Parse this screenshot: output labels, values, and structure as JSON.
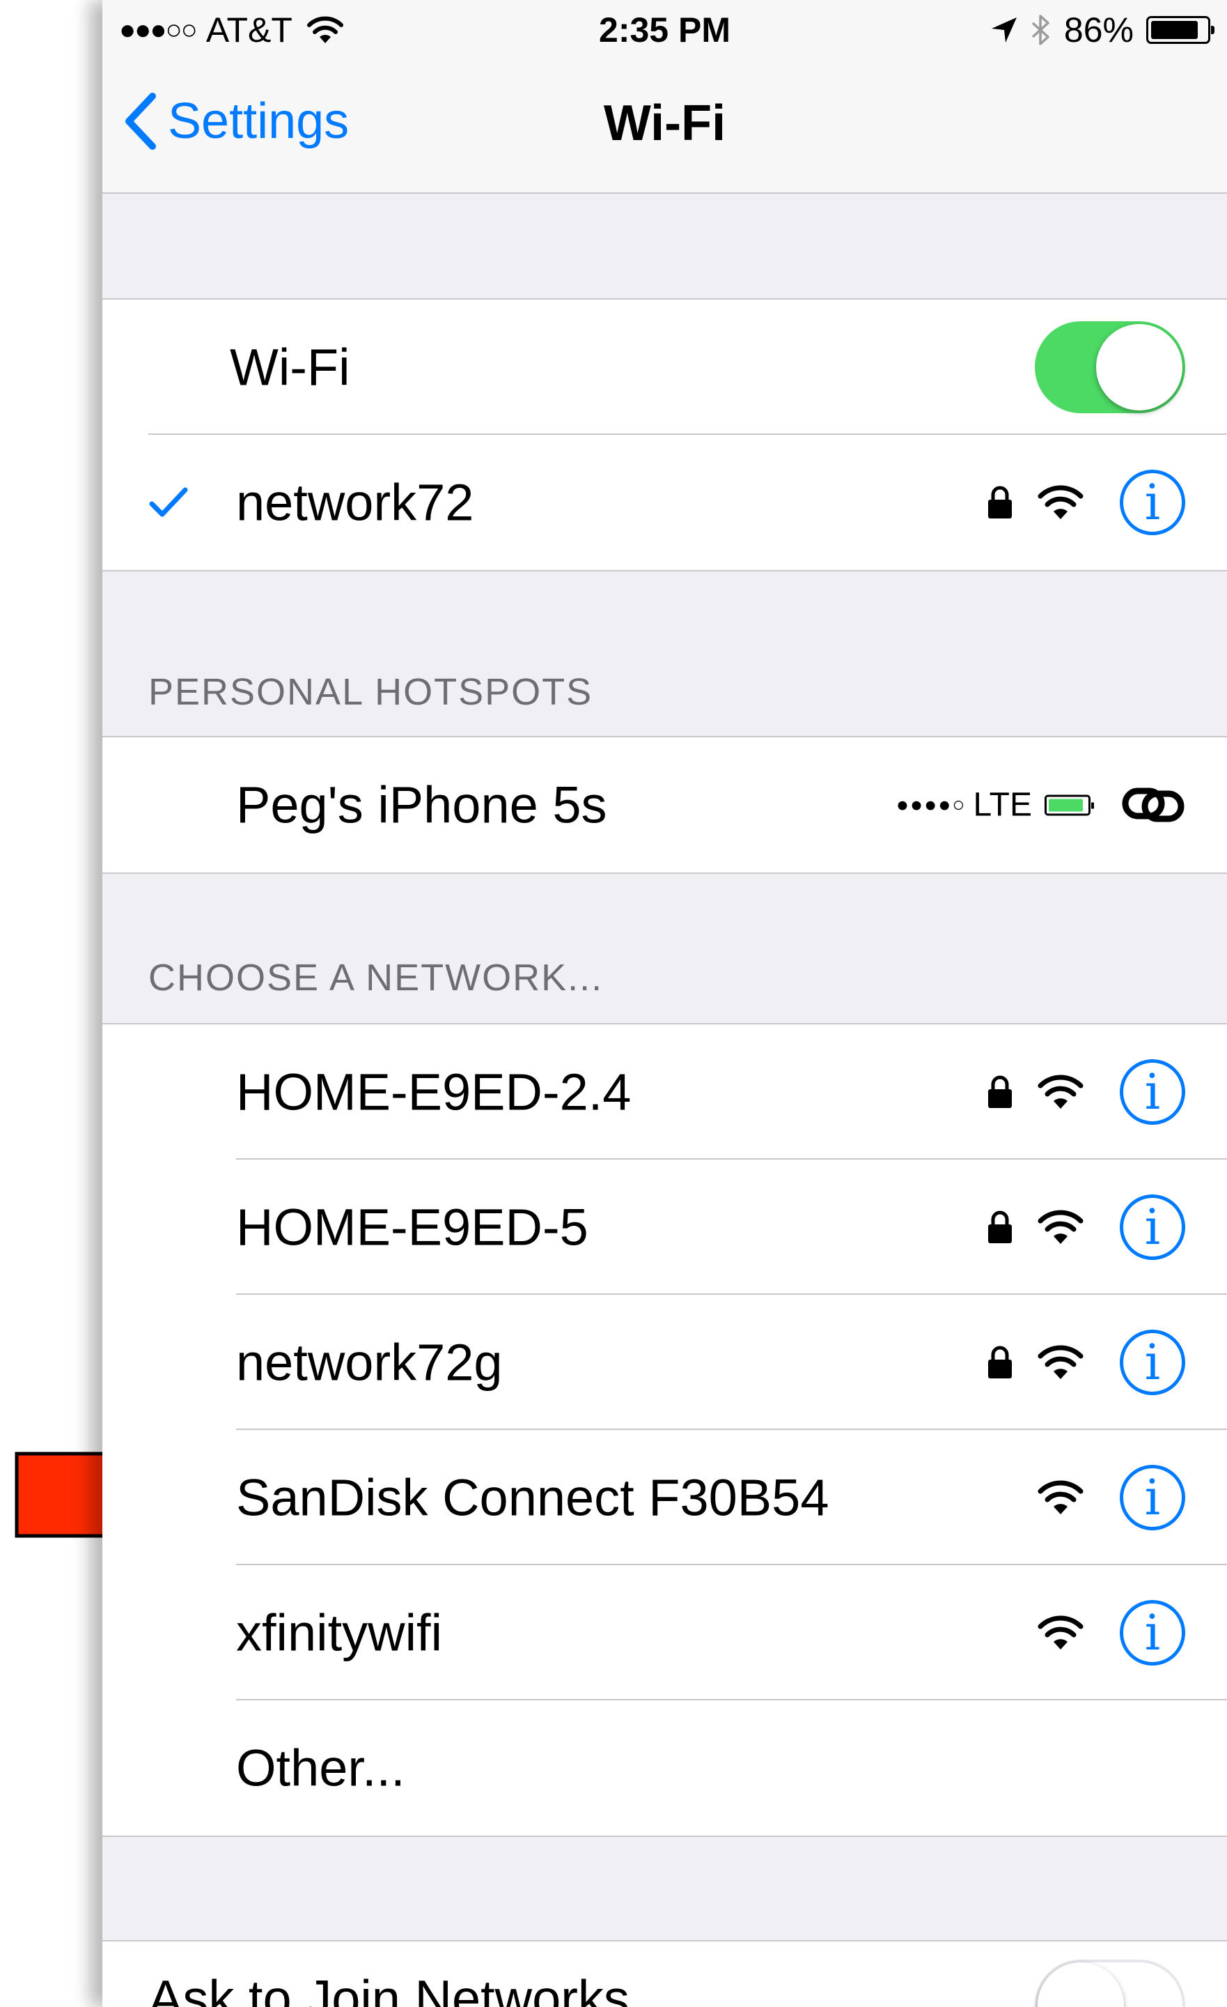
{
  "status_bar": {
    "signal": "●●●○○",
    "carrier": "AT&T",
    "time": "2:35 PM",
    "battery_percent": "86%",
    "battery_level": 0.86
  },
  "nav": {
    "back_label": "Settings",
    "title": "Wi-Fi"
  },
  "wifi": {
    "label": "Wi-Fi",
    "enabled": true,
    "connected_network": "network72"
  },
  "hotspots": {
    "header": "PERSONAL HOTSPOTS",
    "items": [
      {
        "name": "Peg's iPhone 5s",
        "signal": "●●●●○",
        "network_type": "LTE"
      }
    ]
  },
  "networks": {
    "header": "CHOOSE A NETWORK...",
    "items": [
      {
        "name": "HOME-E9ED-2.4",
        "locked": true
      },
      {
        "name": "HOME-E9ED-5",
        "locked": true
      },
      {
        "name": "network72g",
        "locked": true
      },
      {
        "name": "SanDisk Connect F30B54",
        "locked": false
      },
      {
        "name": "xfinitywifi",
        "locked": false
      }
    ],
    "other_label": "Other..."
  },
  "ask_to_join": {
    "label": "Ask to Join Networks",
    "enabled": false
  },
  "info_glyph": "i",
  "colors": {
    "accent": "#007aff",
    "toggle_on": "#4cd964",
    "arrow": "#ff2a00"
  },
  "icons": [
    "chevron-left-icon",
    "checkmark-icon",
    "lock-icon",
    "wifi-icon",
    "info-icon",
    "link-icon",
    "location-arrow-icon",
    "bluetooth-icon",
    "battery-icon",
    "red-arrow-icon"
  ]
}
